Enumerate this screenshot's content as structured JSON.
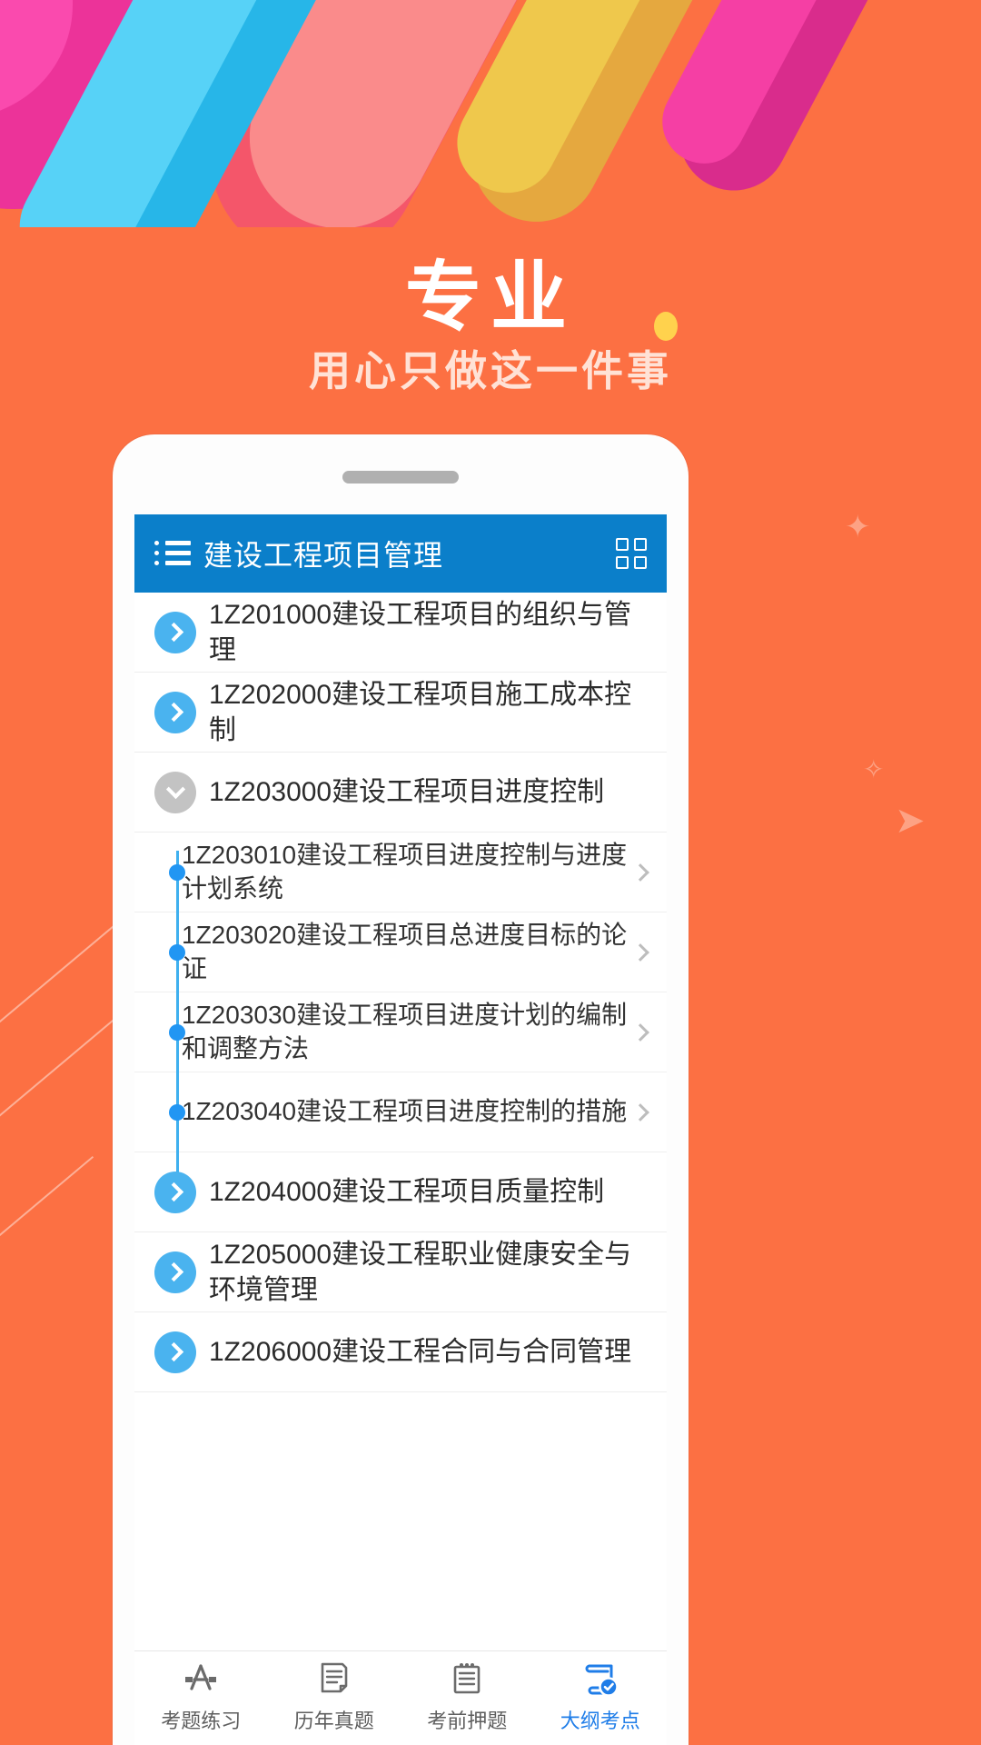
{
  "promo": {
    "headline": "专业",
    "subtitle": "用心只做这一件事"
  },
  "colors": {
    "background": "#fc7043",
    "header_blue": "#0b7fca",
    "accent_blue": "#4ab3ef",
    "tree_line": "#3fb0ef",
    "dot_blue": "#2196f3",
    "collapsed_gray": "#c3c3c3",
    "active_tab": "#1f7de8",
    "subtitle": "#ffe2d6",
    "deco_magenta": "#ec3399",
    "deco_pink": "#fa4aae",
    "deco_salmon": "#fa8b8b",
    "deco_red": "#f4566a",
    "deco_cyan": "#57d2f7",
    "deco_blue": "#27b6e8",
    "deco_yellow": "#efc84c",
    "deco_gold": "#e5a83f",
    "deco_dot": "#ffd24d"
  },
  "app": {
    "header": {
      "menu_icon": "list-icon",
      "title": "建设工程项目管理",
      "grid_icon": "grid-icon"
    },
    "list": [
      {
        "id": "1Z201000",
        "label": "1Z201000建设工程项目的组织与管理",
        "expanded": false,
        "icon": "chevron-right-icon"
      },
      {
        "id": "1Z202000",
        "label": "1Z202000建设工程项目施工成本控制",
        "expanded": false,
        "icon": "chevron-right-icon"
      },
      {
        "id": "1Z203000",
        "label": "1Z203000建设工程项目进度控制",
        "expanded": true,
        "icon": "chevron-down-icon",
        "children": [
          {
            "id": "1Z203010",
            "label": "1Z203010建设工程项目进度控制与进度计划系统"
          },
          {
            "id": "1Z203020",
            "label": "1Z203020建设工程项目总进度目标的论证"
          },
          {
            "id": "1Z203030",
            "label": "1Z203030建设工程项目进度计划的编制和调整方法"
          },
          {
            "id": "1Z203040",
            "label": "1Z203040建设工程项目进度控制的措施"
          }
        ]
      },
      {
        "id": "1Z204000",
        "label": "1Z204000建设工程项目质量控制",
        "expanded": false,
        "icon": "chevron-right-icon"
      },
      {
        "id": "1Z205000",
        "label": "1Z205000建设工程职业健康安全与环境管理",
        "expanded": false,
        "icon": "chevron-right-icon"
      },
      {
        "id": "1Z206000",
        "label": "1Z206000建设工程合同与合同管理",
        "expanded": false,
        "icon": "chevron-right-icon"
      }
    ],
    "tabs": [
      {
        "label": "考题练习",
        "icon": "appstore-icon",
        "active": false
      },
      {
        "label": "历年真题",
        "icon": "document-icon",
        "active": false
      },
      {
        "label": "考前押题",
        "icon": "notepad-icon",
        "active": false
      },
      {
        "label": "大纲考点",
        "icon": "book-check-icon",
        "active": true
      }
    ]
  }
}
